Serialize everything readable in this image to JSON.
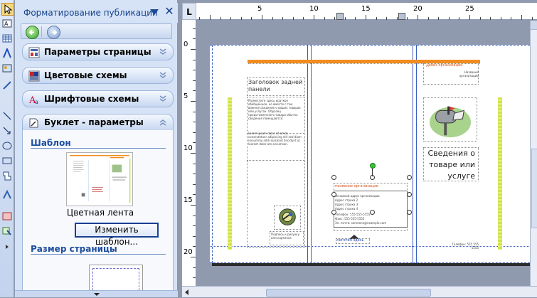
{
  "taskpane": {
    "title": "Форматирование публикации",
    "close": "✕",
    "sections": [
      {
        "label": "Параметры страницы"
      },
      {
        "label": "Цветовые схемы"
      },
      {
        "label": "Шрифтовые схемы"
      },
      {
        "label": "Буклет - параметры"
      }
    ],
    "template_heading": "Шаблон",
    "template_name": "Цветная лента",
    "change_template_button": "Изменить шаблон...",
    "page_size_heading": "Размер страницы"
  },
  "ruler": {
    "corner": "L",
    "h_labels": [
      "5",
      "10",
      "15",
      "20",
      "25"
    ],
    "v_labels": [
      "0",
      "5",
      "10",
      "15",
      "20"
    ]
  },
  "document": {
    "org_name_right": "Название организации",
    "panel1": {
      "heading": "Заголовок задней панели",
      "text1": "Разместите здесь краткое обобщённое, но вместе с тем важное сведение о ваших товарах или услугах. Образец представленного товара обычно сведения помещаются.",
      "text2": "Lorem ipsum dolor sit amet, consectetuer adipiscing elit sed diam nonummy nibh euismod tincidunt ut laoreet dolor am accumsan.",
      "caption": "Подпись к рисунку или картинке"
    },
    "panel2": {
      "org_name": "Название организации",
      "address_lines": [
        "Основной адрес организации",
        "Адрес строка 2",
        "Адрес строка 3",
        "Адрес строка 4"
      ],
      "contact_lines": [
        "Телефон: 555-555-5555",
        "Факс: 555-555-5555",
        "Эл. почта: someone@example.com"
      ],
      "logo_caption": "Логотип здесь"
    },
    "panel3": {
      "slogan": "Девиз организации",
      "title": "Сведения о товаре или услуге",
      "phone": "Телефон: 555 555 5555"
    }
  }
}
